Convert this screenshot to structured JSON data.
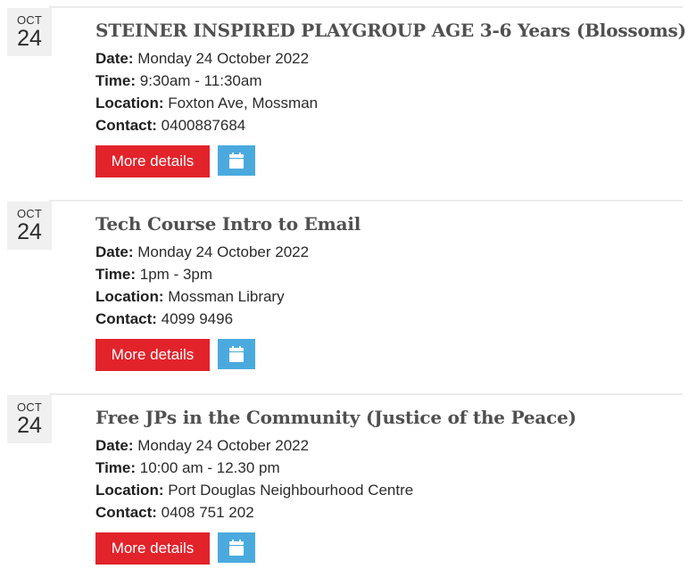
{
  "colors": {
    "more_button_bg": "#e2232a",
    "calendar_button_bg": "#4aaade",
    "date_badge_bg": "#f0f0f0",
    "title_text": "#505050"
  },
  "icons": {
    "calendar": "calendar-icon"
  },
  "events": [
    {
      "month": "OCT",
      "day": "24",
      "title": "STEINER INSPIRED PLAYGROUP AGE 3-6 Years (Blossoms)",
      "date_label": "Date:",
      "date_value": " Monday 24 October 2022",
      "time_label": "Time:",
      "time_value": " 9:30am - 11:30am",
      "location_label": "Location:",
      "location_value": " Foxton Ave, Mossman",
      "contact_label": "Contact:",
      "contact_value": " 0400887684",
      "more_label": "More details"
    },
    {
      "month": "OCT",
      "day": "24",
      "title": "Tech Course Intro to Email",
      "date_label": "Date:",
      "date_value": " Monday 24 October 2022",
      "time_label": "Time:",
      "time_value": " 1pm - 3pm",
      "location_label": "Location:",
      "location_value": " Mossman Library",
      "contact_label": "Contact:",
      "contact_value": " 4099 9496",
      "more_label": "More details"
    },
    {
      "month": "OCT",
      "day": "24",
      "title": "Free JPs in the Community (Justice of the Peace)",
      "date_label": "Date:",
      "date_value": " Monday 24 October 2022",
      "time_label": "Time:",
      "time_value": " 10:00 am - 12.30 pm",
      "location_label": "Location:",
      "location_value": " Port Douglas Neighbourhood Centre",
      "contact_label": "Contact:",
      "contact_value": " 0408 751 202",
      "more_label": "More details"
    }
  ]
}
